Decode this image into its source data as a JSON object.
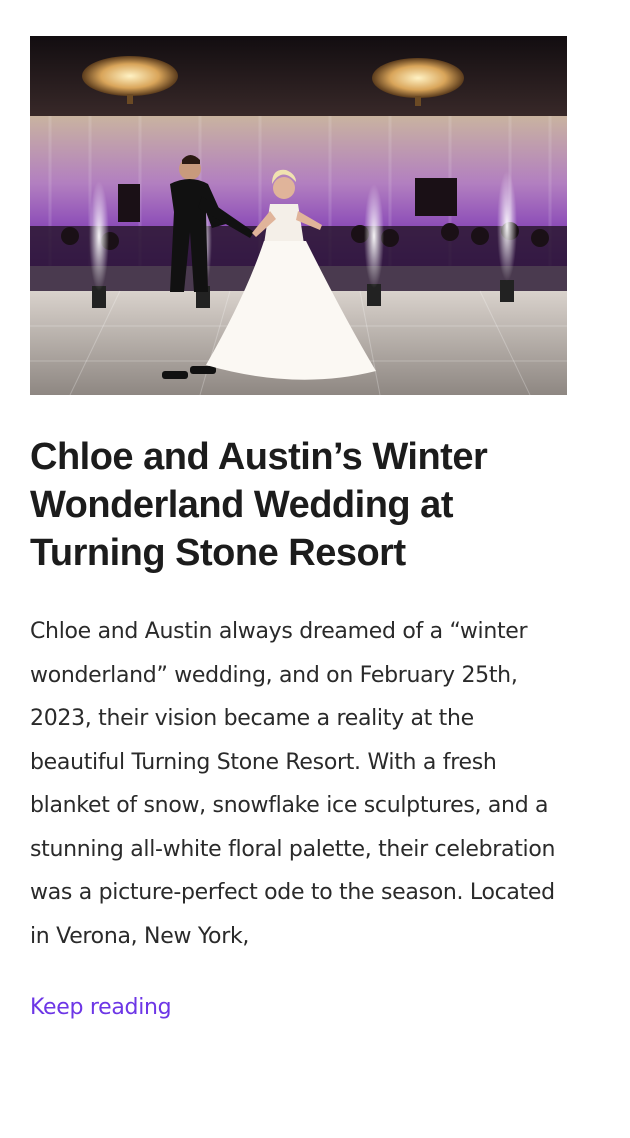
{
  "post": {
    "image_alt": "Bride and groom dancing on a white dance floor with sparklers and purple uplighting",
    "title": "Chloe and Austin’s Winter Wonderland Wedding at Turning Stone Resort",
    "excerpt": "Chloe and Austin always dreamed of a “winter wonderland” wedding, and on February 25th, 2023, their vision became a reality at the beautiful Turning Stone Resort. With a fresh blanket of snow, snowflake ice sculptures, and a stunning all-white floral palette, their celebration was a picture-perfect ode to the season. Located in Verona, New York,",
    "read_more_label": "Keep reading"
  },
  "colors": {
    "title": "#1c1c1c",
    "body_text": "#2a2a2a",
    "link": "#6d36e6",
    "uplight": "#8a2be2"
  }
}
